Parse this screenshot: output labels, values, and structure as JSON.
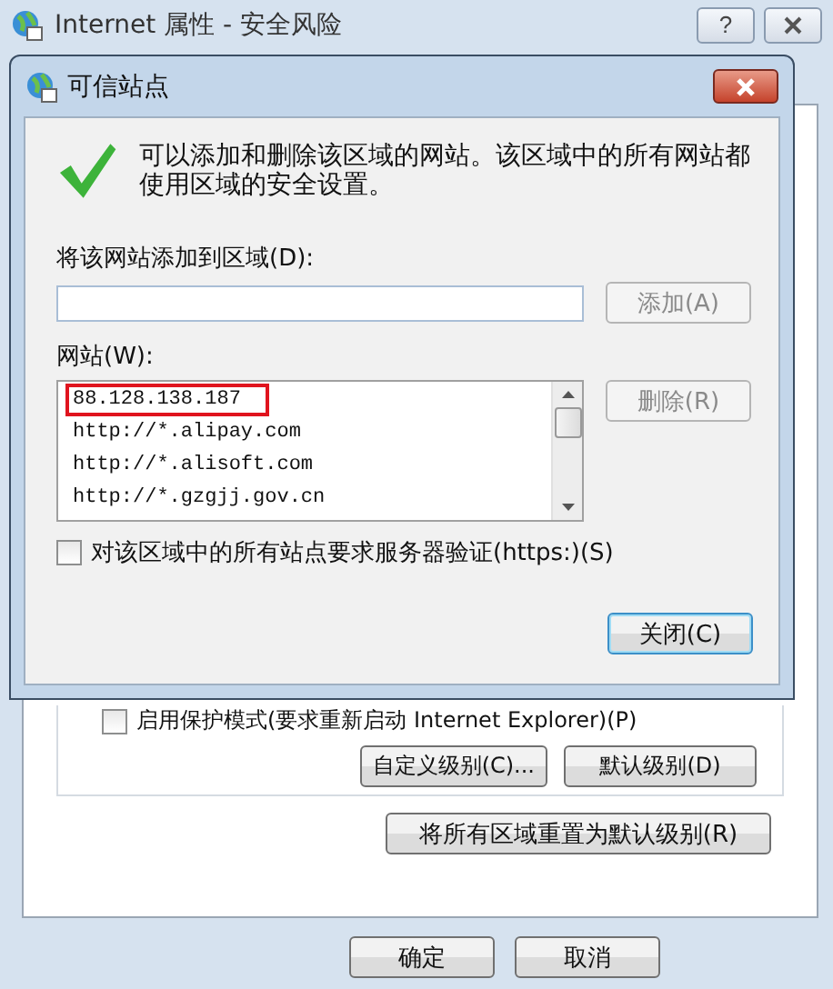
{
  "window": {
    "title": "Internet 属性 - 安全风险",
    "help_button": "?"
  },
  "dialog": {
    "title": "可信站点",
    "message": "可以添加和删除该区域的网站。该区域中的所有网站都使用区域的安全设置。",
    "add_label": "将该网站添加到区域(D):",
    "add_button": {
      "label": "添加(A)",
      "disabled": true
    },
    "sites_label": "网站(W):",
    "sites": [
      {
        "text": "88.128.138.187",
        "highlighted": true
      },
      {
        "text": "http://*.alipay.com",
        "highlighted": false
      },
      {
        "text": "http://*.alisoft.com",
        "highlighted": false
      },
      {
        "text": "http://*.gzgjj.gov.cn",
        "highlighted": false
      }
    ],
    "remove_button": {
      "label": "删除(R)",
      "disabled": true
    },
    "https_checkbox": {
      "label": "对该区域中的所有站点要求服务器验证(https:)(S)",
      "checked": false
    },
    "close_button": "关闭(C)"
  },
  "background": {
    "protected_mode": {
      "label": "启用保护模式(要求重新启动 Internet Explorer)(P)",
      "checked": false
    },
    "custom_level_button": "自定义级别(C)...",
    "default_level_button": "默认级别(D)",
    "reset_all_button": "将所有区域重置为默认级别(R)",
    "ok_button": "确定",
    "cancel_button": "取消"
  }
}
